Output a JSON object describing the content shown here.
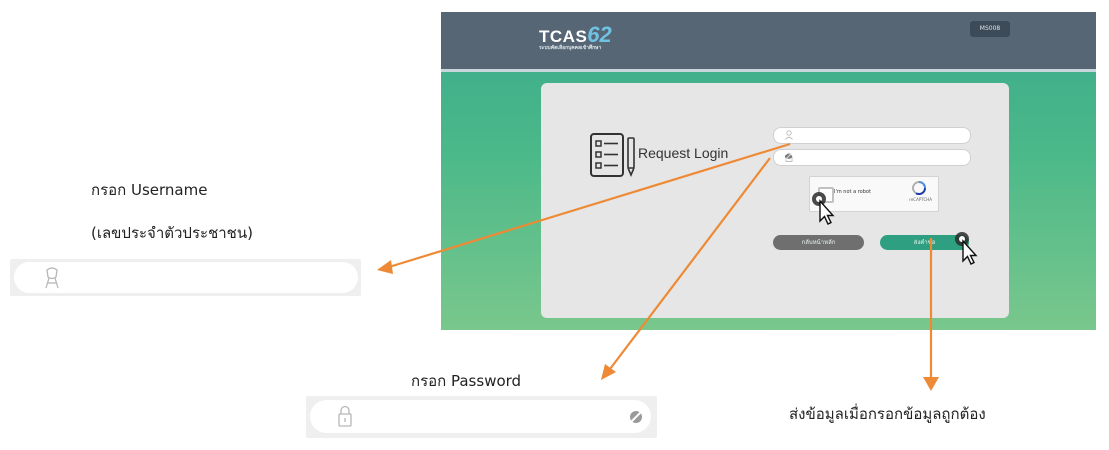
{
  "screenshot": {
    "logo_text": "TCAS",
    "logo_number": "62",
    "logo_subtitle": "ระบบคัดเลือกบุคคลเข้าศึกษา",
    "topbar_button": "MS008",
    "card_title": "Request Login",
    "recaptcha_label": "I'm not a robot",
    "recaptcha_brand": "reCAPTCHA",
    "back_button": "กลับหน้าหลัก",
    "submit_button": "ส่งคำขอ"
  },
  "annotations": {
    "username_label": "กรอก Username",
    "username_hint": "(เลขประจำตัวประชาชน)",
    "password_label": "กรอก Password",
    "submit_note": "ส่งข้อมูลเมื่อกรอกข้อมูลถูกต้อง"
  },
  "colors": {
    "topbar": "#566675",
    "gradient_top": "#3aa98a",
    "gradient_bottom": "#79c78c",
    "submit_button": "#2e9f80",
    "back_button": "#6f6f6f",
    "arrow": "#ee8a35"
  },
  "icons": [
    "user-icon",
    "lock-icon",
    "eye-slash-icon",
    "document-checklist-icon",
    "pencil-icon",
    "recaptcha-icon",
    "cursor-icon"
  ]
}
